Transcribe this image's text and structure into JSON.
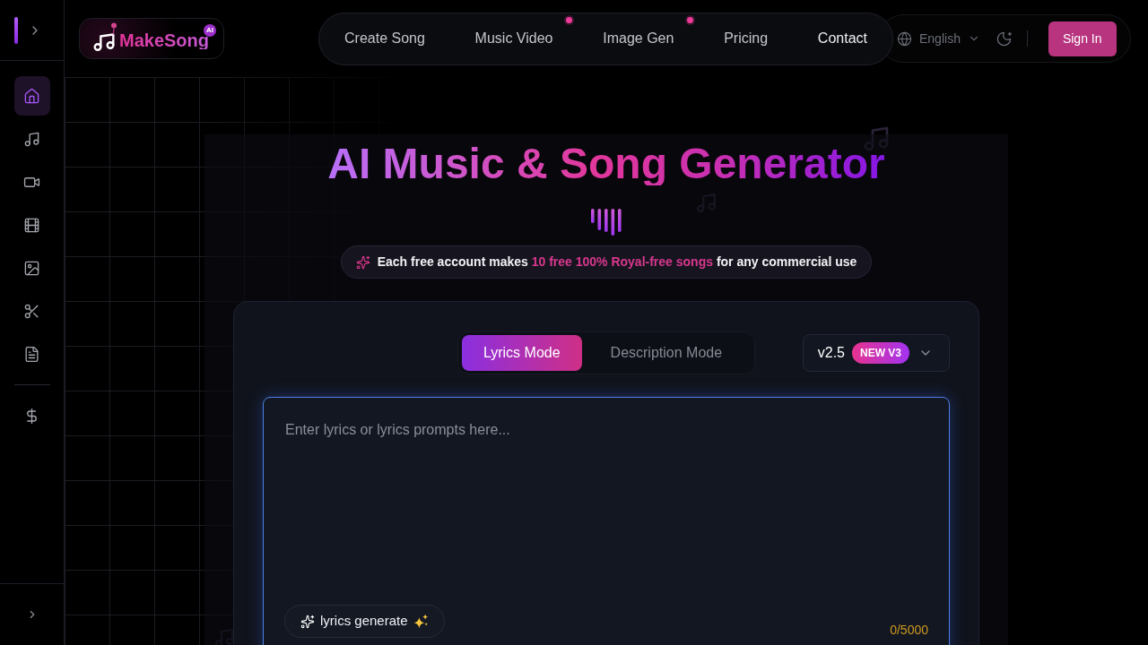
{
  "sidebar": {
    "groups": [
      {
        "items": [
          {
            "selected": true
          },
          {
            "selected": false
          },
          {
            "selected": false
          },
          {
            "selected": false
          },
          {
            "selected": false
          },
          {
            "selected": false
          },
          {
            "selected": false
          }
        ]
      },
      {
        "items": [
          {
            "selected": false
          }
        ]
      }
    ]
  },
  "logo": {
    "name": "MakeSong",
    "badge": "AI"
  },
  "nav": {
    "items": [
      {
        "label": "Create Song",
        "selected": false,
        "dot": false
      },
      {
        "label": "Music Video",
        "selected": false,
        "dot": true
      },
      {
        "label": "Image Gen",
        "selected": false,
        "dot": true
      },
      {
        "label": "Pricing",
        "selected": false,
        "dot": false
      },
      {
        "label": "Contact",
        "selected": true,
        "dot": false
      }
    ]
  },
  "language": {
    "label": "English"
  },
  "sign_in": "Sign In",
  "hero": {
    "title": "AI Music & Song Generator",
    "notice": {
      "before": "Each free account makes ",
      "highlight": "10 free 100% Royal-free songs",
      "after": " for any commercial use"
    }
  },
  "generator": {
    "modes": [
      {
        "label": "Lyrics Mode",
        "selected": true
      },
      {
        "label": "Description Mode",
        "selected": false
      }
    ],
    "version": {
      "value": "v2.5",
      "badge": "NEW V3"
    },
    "lyrics": {
      "placeholder": "Enter lyrics or lyrics prompts here..."
    },
    "generate_button": "lyrics generate",
    "counter": "0/5000"
  }
}
